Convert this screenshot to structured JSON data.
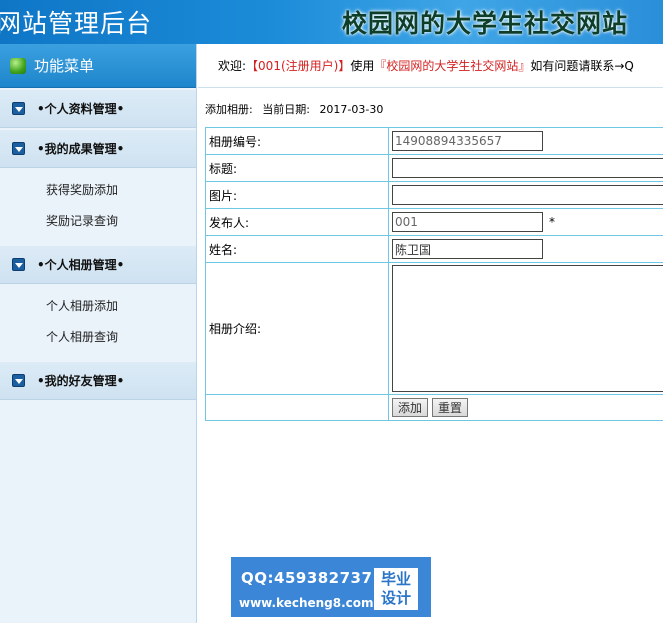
{
  "header": {
    "admin_title": "网站管理后台",
    "site_title": "校园网的大学生社交网站"
  },
  "sidebar": {
    "menu_title": "功能菜单",
    "groups": [
      {
        "label": "•个人资料管理•",
        "items": []
      },
      {
        "label": "•我的成果管理•",
        "items": [
          "获得奖励添加",
          "奖励记录查询"
        ]
      },
      {
        "label": "•个人相册管理•",
        "items": [
          "个人相册添加",
          "个人相册查询"
        ]
      },
      {
        "label": "•我的好友管理•",
        "items": []
      }
    ]
  },
  "welcome": {
    "prefix": "欢迎:",
    "user": "【001(注册用户)】",
    "middle": "使用",
    "site": "『校园网的大学生社交网站』",
    "suffix": "如有问题请联系→Q"
  },
  "breadcrumb": {
    "action": "添加相册:",
    "date_label": "当前日期:",
    "date": "2017-03-30"
  },
  "form": {
    "album_id_label": "相册编号:",
    "album_id_value": "14908894335657",
    "title_label": "标题:",
    "title_value": "",
    "image_label": "图片:",
    "image_value": "",
    "publisher_label": "发布人:",
    "publisher_value": "001",
    "publisher_required": "*",
    "name_label": "姓名:",
    "name_value": "陈卫国",
    "intro_label": "相册介绍:",
    "intro_value": "",
    "add_button": "添加",
    "reset_button": "重置"
  },
  "watermark": {
    "qq": "QQ:459382737",
    "url": "www.kecheng8.com",
    "badge_line1": "毕业",
    "badge_line2": "设计"
  }
}
